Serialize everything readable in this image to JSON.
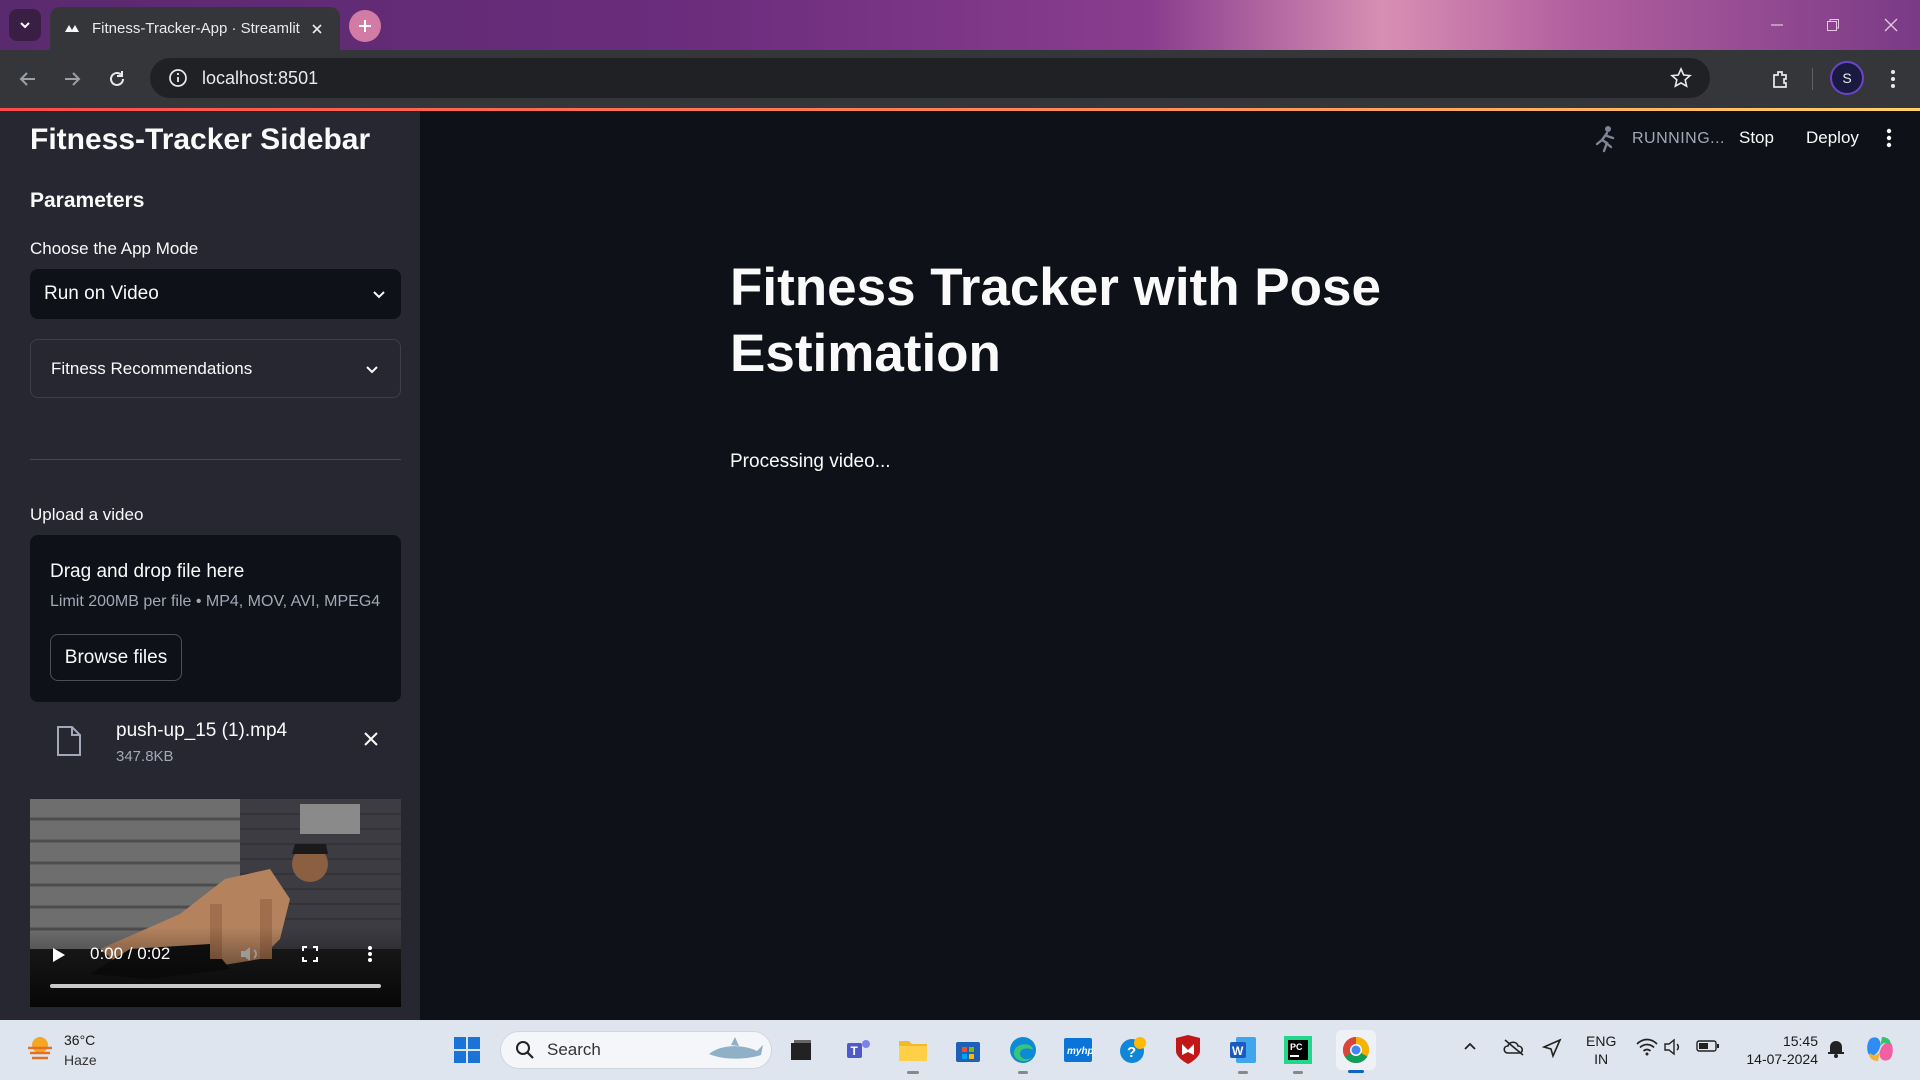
{
  "browser": {
    "tab_title": "Fitness-Tracker-App · Streamlit",
    "url": "localhost:8501",
    "profile_initial": "S"
  },
  "sidebar": {
    "title": "Fitness-Tracker Sidebar",
    "params_heading": "Parameters",
    "mode_label": "Choose the App Mode",
    "mode_value": "Run on Video",
    "expander_label": "Fitness Recommendations",
    "upload_label": "Upload a video",
    "uploader": {
      "drag_text": "Drag and drop file here",
      "limit_text": "Limit 200MB per file • MP4, MOV, AVI, MPEG4",
      "browse_label": "Browse files"
    },
    "file": {
      "name": "push-up_15 (1).mp4",
      "size": "347.8KB"
    },
    "video": {
      "time": "0:00 / 0:02"
    }
  },
  "header": {
    "status": "RUNNING...",
    "stop_label": "Stop",
    "deploy_label": "Deploy"
  },
  "main": {
    "title": "Fitness Tracker with Pose Estimation",
    "status_text": "Processing video..."
  },
  "taskbar": {
    "temperature": "36°C",
    "condition": "Haze",
    "search_label": "Search",
    "lang_line1": "ENG",
    "lang_line2": "IN",
    "time": "15:45",
    "date": "14-07-2024"
  },
  "colors": {
    "app_bg": "#0e1117",
    "sidebar_bg": "#262730",
    "accent": "#ff4b4b",
    "text": "#fafafa"
  }
}
